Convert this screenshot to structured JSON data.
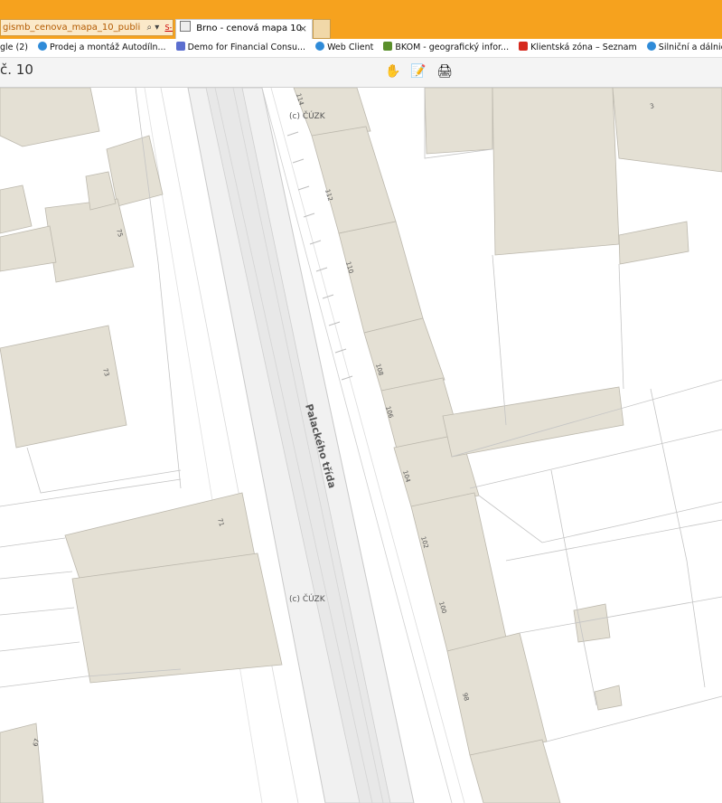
{
  "browser": {
    "address_text": "gismb_cenova_mapa_10_publi",
    "rank_label": "S-Rank",
    "tab_title": "Brno - cenová mapa 10",
    "tab_close": "×"
  },
  "favorites": [
    {
      "label": "gle (2)",
      "icon": "ie-icon"
    },
    {
      "label": "Prodej a montáž  Autodíln...",
      "icon": "ie-icon"
    },
    {
      "label": "Demo for Financial Consu...",
      "icon": "demo-icon"
    },
    {
      "label": "Web Client",
      "icon": "ie-icon"
    },
    {
      "label": "BKOM - geografický infor...",
      "icon": "bkom-icon"
    },
    {
      "label": "Klientská zóna – Seznam",
      "icon": "seznam-icon"
    },
    {
      "label": "Silniční a dálniční síť ČR",
      "icon": "ie-icon"
    }
  ],
  "page": {
    "title": "č. 10",
    "tools": [
      {
        "name": "pan-tool-icon",
        "glyph": "✋"
      },
      {
        "name": "edit-note-icon",
        "glyph": "📝"
      },
      {
        "name": "print-icon",
        "glyph": "🖨"
      }
    ]
  },
  "map": {
    "street_name": "Palackého třída",
    "copyright": [
      "(c) ČÚZK",
      "(c) ČÚZK"
    ],
    "house_numbers": [
      "114",
      "112",
      "110",
      "108",
      "106",
      "104",
      "102",
      "100",
      "98",
      "75",
      "73",
      "71",
      "67",
      "3"
    ],
    "colors": {
      "building": "#e4e0d4",
      "road": "#ededed",
      "background": "#ffffff",
      "accent": "#f6a21e"
    }
  }
}
